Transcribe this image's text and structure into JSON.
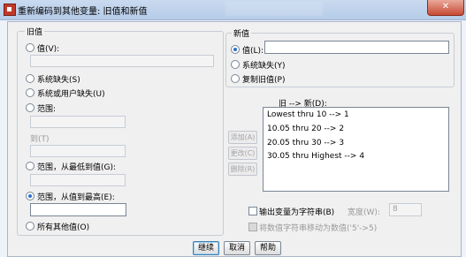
{
  "window": {
    "title": "重新编码到其他变量: 旧值和新值",
    "close_glyph": "✕"
  },
  "old_value": {
    "legend": "旧值",
    "value_radio": "值(V):",
    "system_missing": "系统缺失(S)",
    "system_or_user_missing": "系统或用户缺失(U)",
    "range": "范围:",
    "through": "到(T)",
    "range_lowest": "范围，从最低到值(G):",
    "range_highest": "范围，从值到最高(E):",
    "all_other": "所有其他值(O)",
    "selected": "range_highest"
  },
  "new_value": {
    "legend": "新值",
    "value_radio": "值(L):",
    "value_input": "",
    "system_missing": "系统缺失(Y)",
    "copy_old": "复制旧值(P)",
    "selected": "value"
  },
  "mapping": {
    "label": "旧 --> 新(D):",
    "items": [
      "Lowest thru 10 --> 1",
      "10.05 thru 20 --> 2",
      "20.05 thru 30 --> 3",
      "30.05 thru Highest --> 4"
    ],
    "add": "添加(A)",
    "change": "更改(C)",
    "remove": "删除(R)"
  },
  "options": {
    "output_as_string": "输出变量为字符串(B)",
    "width_label": "宽度(W):",
    "width_value": "8",
    "convert_numeric": "将数值字符串移动为数值('5'->5)"
  },
  "buttons": {
    "continue": "继续",
    "cancel": "取消",
    "help": "帮助"
  },
  "colors": {
    "accent": "#2b6fd1",
    "close": "#c74a34"
  }
}
